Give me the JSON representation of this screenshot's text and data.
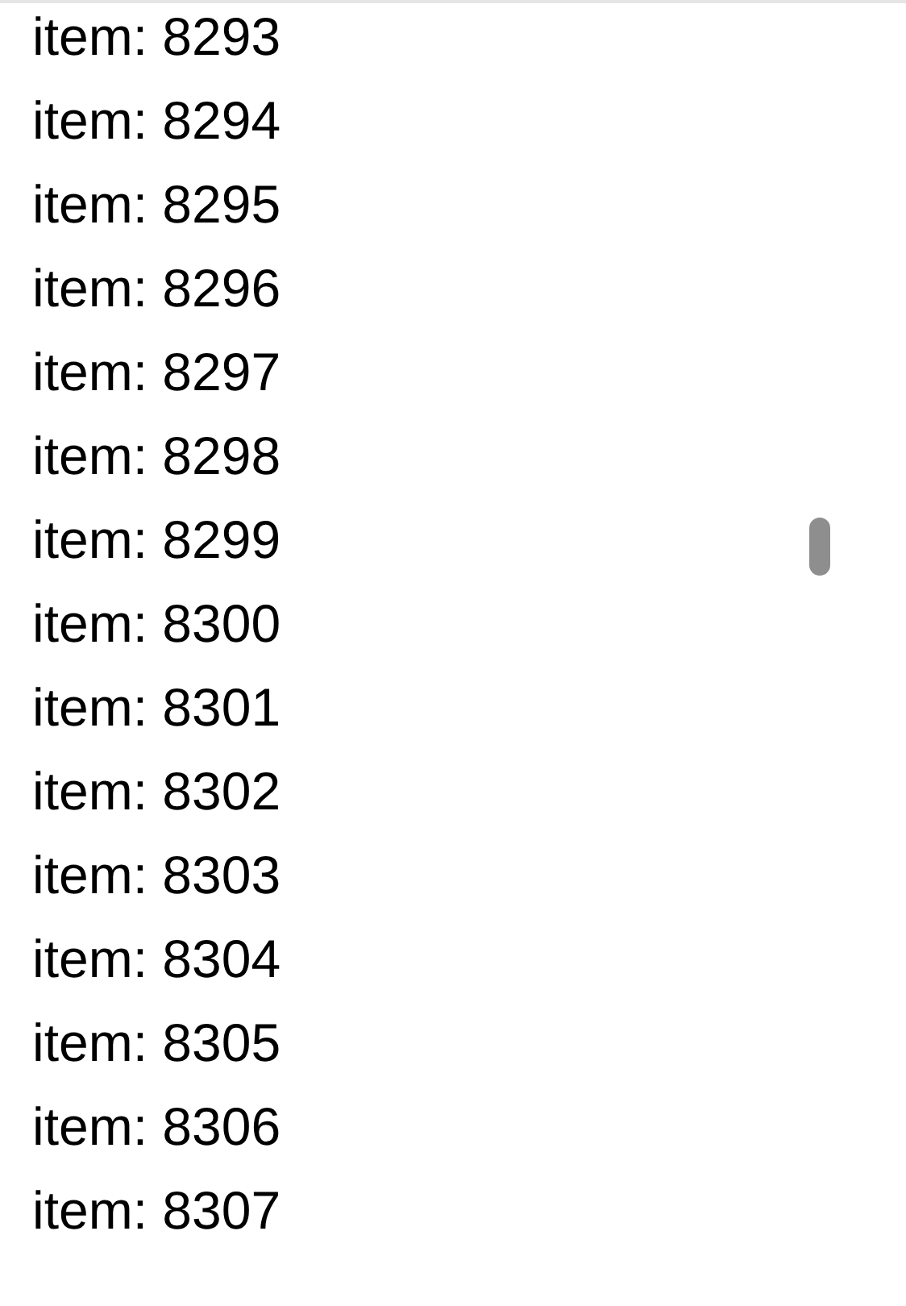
{
  "items": [
    "item: 8293",
    "item: 8294",
    "item: 8295",
    "item: 8296",
    "item: 8297",
    "item: 8298",
    "item: 8299",
    "item: 8300",
    "item: 8301",
    "item: 8302",
    "item: 8303",
    "item: 8304",
    "item: 8305",
    "item: 8306",
    "item: 8307"
  ]
}
